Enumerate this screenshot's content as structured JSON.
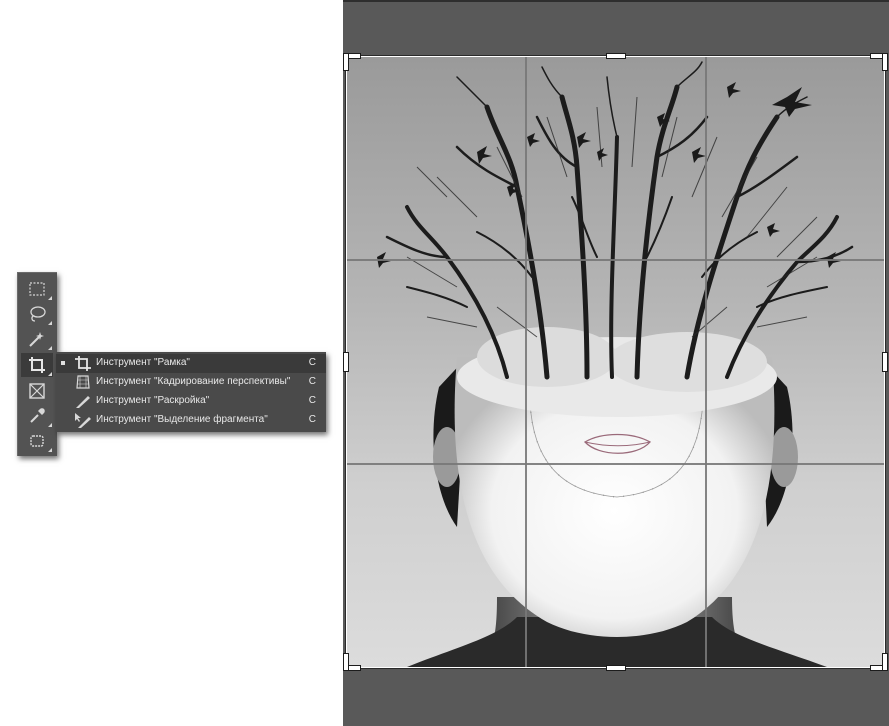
{
  "toolbar": {
    "tools": [
      {
        "name": "marquee-tool",
        "icon": "rect-marquee-icon",
        "active": false
      },
      {
        "name": "lasso-tool",
        "icon": "lasso-icon",
        "active": false
      },
      {
        "name": "magic-wand-tool",
        "icon": "magic-wand-icon",
        "active": false
      },
      {
        "name": "crop-tool",
        "icon": "crop-icon",
        "active": true
      },
      {
        "name": "frame-tool",
        "icon": "frame-icon",
        "active": false
      },
      {
        "name": "eyedropper-tool",
        "icon": "eyedropper-icon",
        "active": false
      },
      {
        "name": "canvas-tool",
        "icon": "canvas-icon",
        "active": false
      }
    ]
  },
  "flyout": {
    "items": [
      {
        "label": "Инструмент \"Рамка\"",
        "shortcut": "C",
        "icon": "crop-icon",
        "selected": true
      },
      {
        "label": "Инструмент \"Кадрирование перспективы\"",
        "shortcut": "C",
        "icon": "perspective-crop-icon",
        "selected": false
      },
      {
        "label": "Инструмент \"Раскройка\"",
        "shortcut": "C",
        "icon": "slice-icon",
        "selected": false
      },
      {
        "label": "Инструмент \"Выделение фрагмента\"",
        "shortcut": "C",
        "icon": "slice-select-icon",
        "selected": false
      }
    ]
  },
  "colors": {
    "toolbar_bg": "#535353",
    "flyout_bg": "#4a4a4a",
    "canvas_bg": "#595959",
    "crop_frame": "#ffffff"
  }
}
